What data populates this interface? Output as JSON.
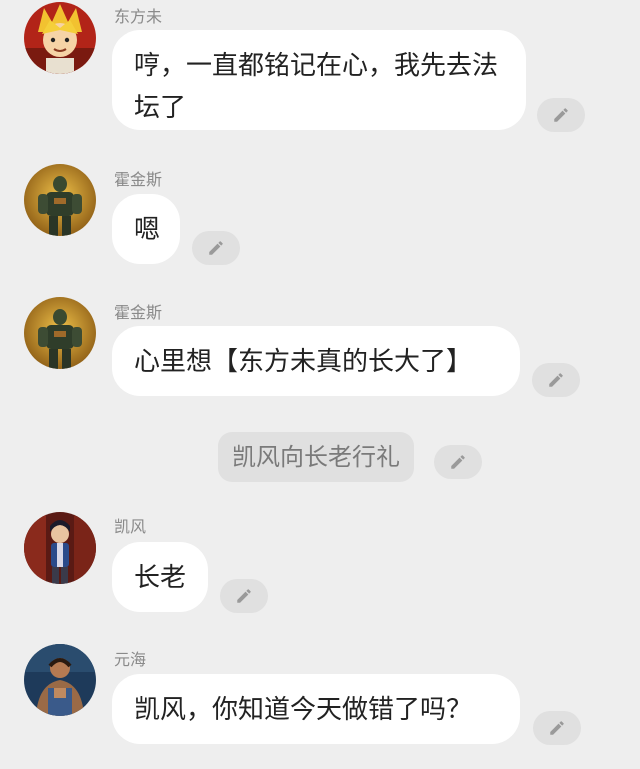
{
  "messages": [
    {
      "name": "东方未",
      "text": "哼，一直都铭记在心，我先去法坛了",
      "avatar_icon": "blond-boy-avatar-icon"
    },
    {
      "name": "霍金斯",
      "text": "嗯",
      "avatar_icon": "armored-warrior-avatar-icon"
    },
    {
      "name": "霍金斯",
      "text": "心里想【东方未真的长大了】",
      "avatar_icon": "armored-warrior-avatar-icon"
    },
    {
      "name": "凯风",
      "text": "长老",
      "avatar_icon": "dark-haired-youth-avatar-icon"
    },
    {
      "name": "元海",
      "text": "凯风，你知道今天做错了吗？",
      "avatar_icon": "muscular-man-avatar-icon"
    }
  ],
  "narration": {
    "text": "凯风向长老行礼"
  },
  "icons": {
    "edit": "pencil-icon"
  },
  "colors": {
    "background": "#eeeeee",
    "bubble": "#ffffff",
    "edit_pill": "#e0e0e0",
    "name_text": "#8a8a8a"
  }
}
